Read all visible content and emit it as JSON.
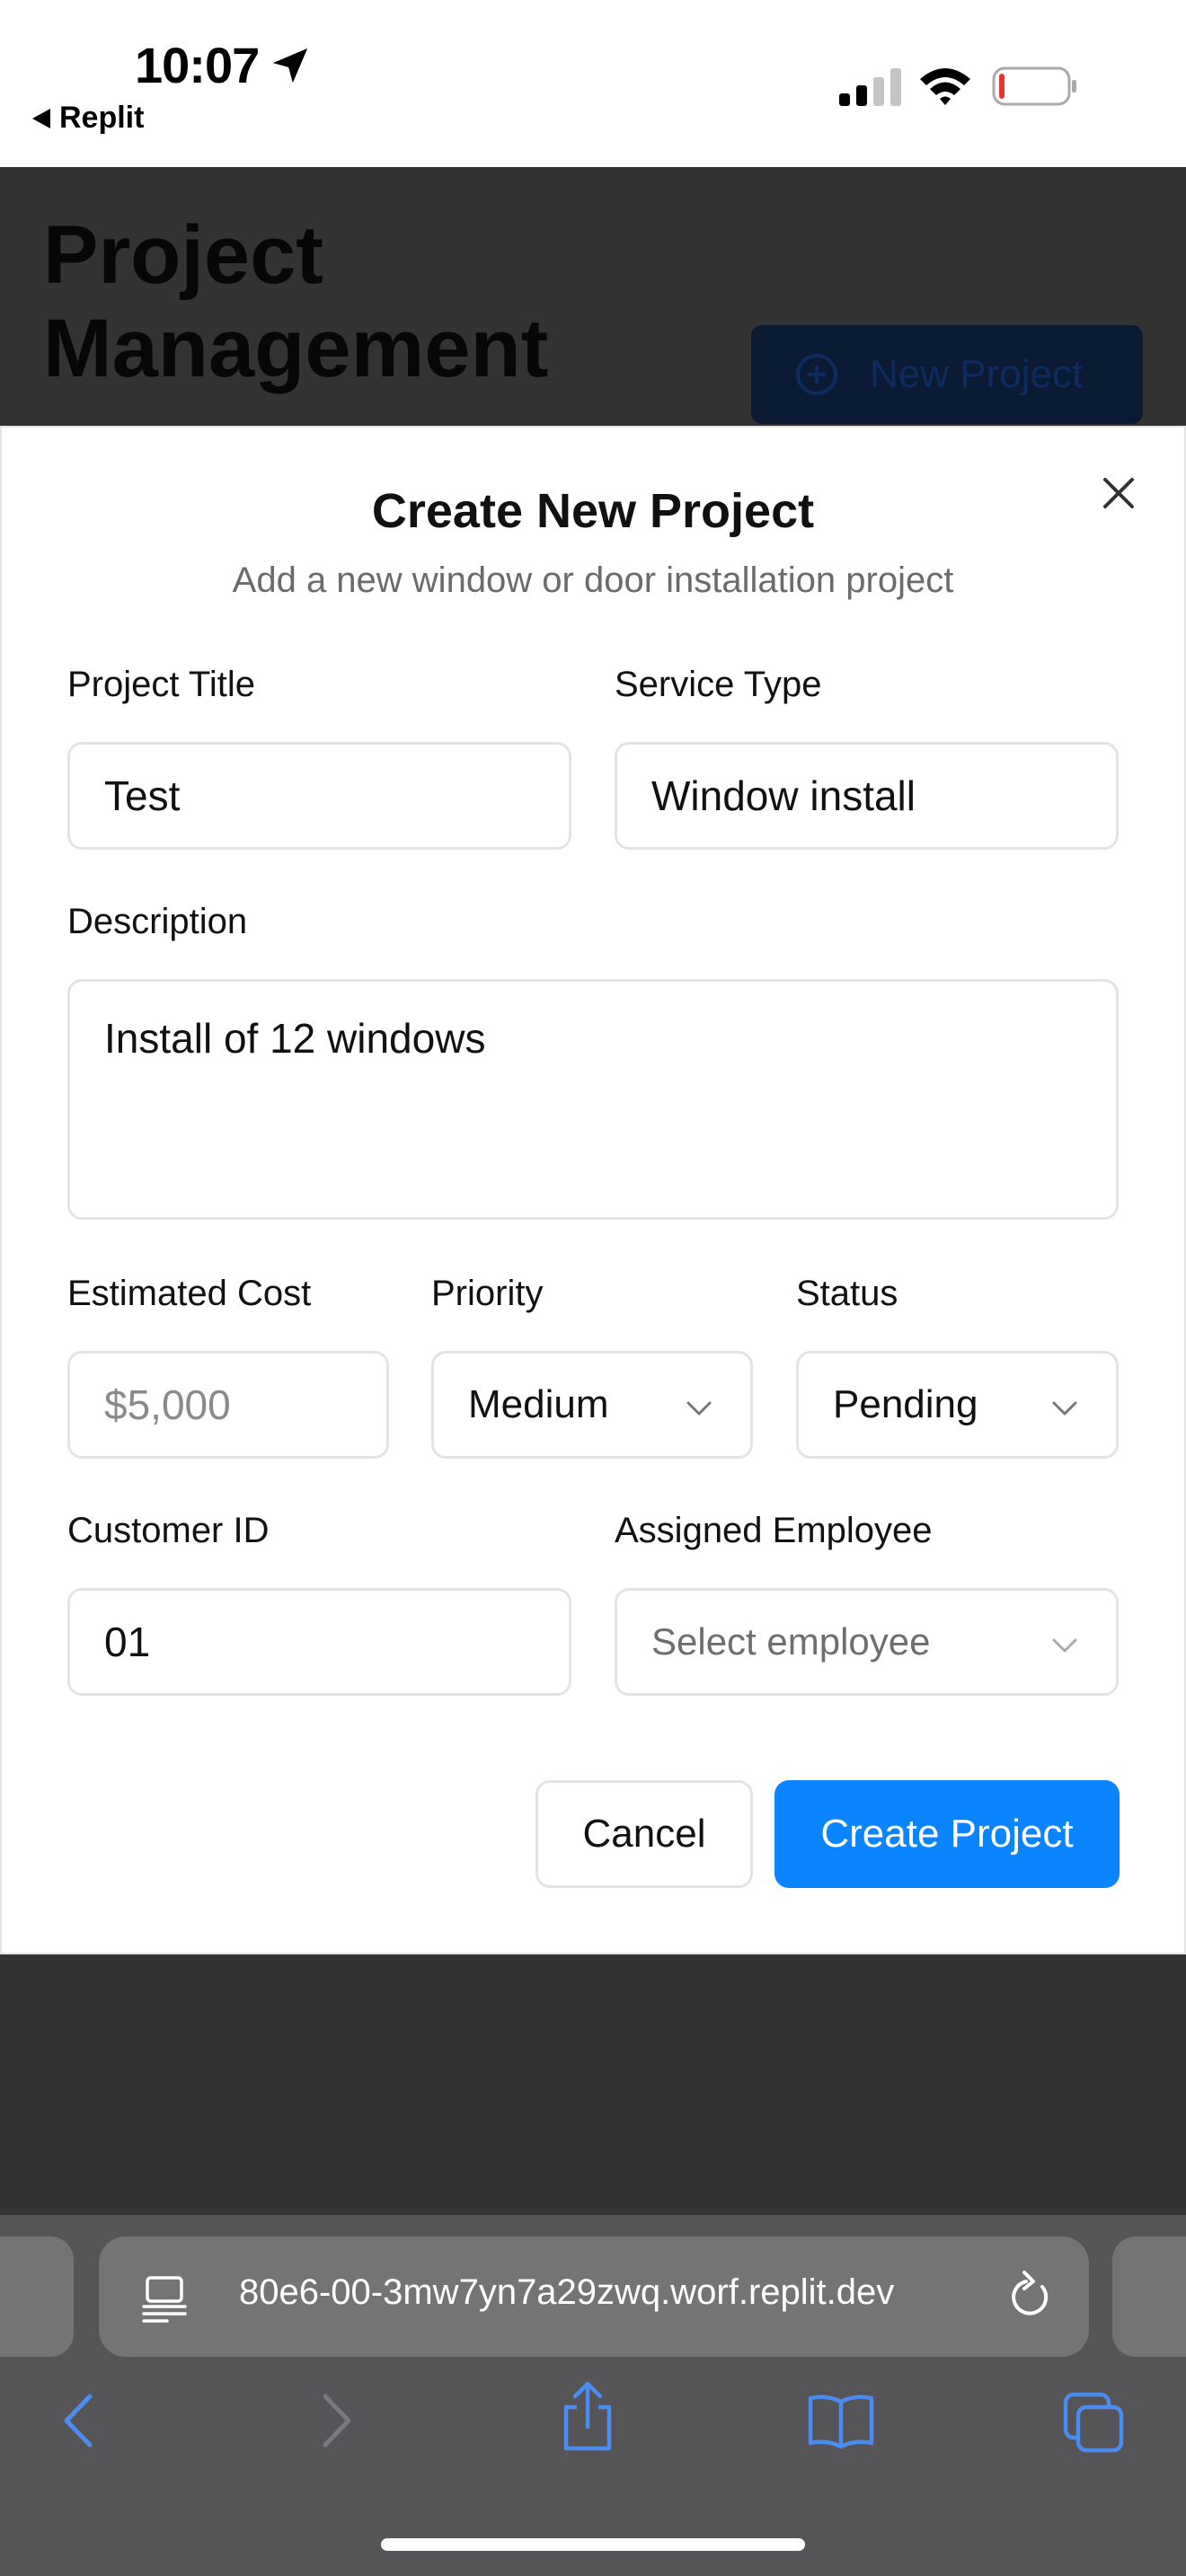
{
  "status_bar": {
    "time": "10:07",
    "back_app": "Replit"
  },
  "page": {
    "title": "Project Management",
    "new_project_label": "New Project"
  },
  "modal": {
    "title": "Create New Project",
    "subtitle": "Add a new window or door installation project",
    "project_title": {
      "label": "Project Title",
      "value": "Test"
    },
    "service_type": {
      "label": "Service Type",
      "value": "Window install"
    },
    "description": {
      "label": "Description",
      "value": "Install of 12 windows"
    },
    "estimated_cost": {
      "label": "Estimated Cost",
      "placeholder": "$5,000"
    },
    "priority": {
      "label": "Priority",
      "value": "Medium"
    },
    "status": {
      "label": "Status",
      "value": "Pending"
    },
    "customer_id": {
      "label": "Customer ID",
      "value": "01"
    },
    "assigned_employee": {
      "label": "Assigned Employee",
      "placeholder": "Select employee"
    },
    "cancel_label": "Cancel",
    "create_label": "Create Project"
  },
  "browser": {
    "url": "80e6-00-3mw7yn7a29zwq.worf.replit.dev",
    "accent_color": "#4a8cf0"
  },
  "colors": {
    "primary_button": "#0a84ff",
    "overlay": "#333333"
  }
}
